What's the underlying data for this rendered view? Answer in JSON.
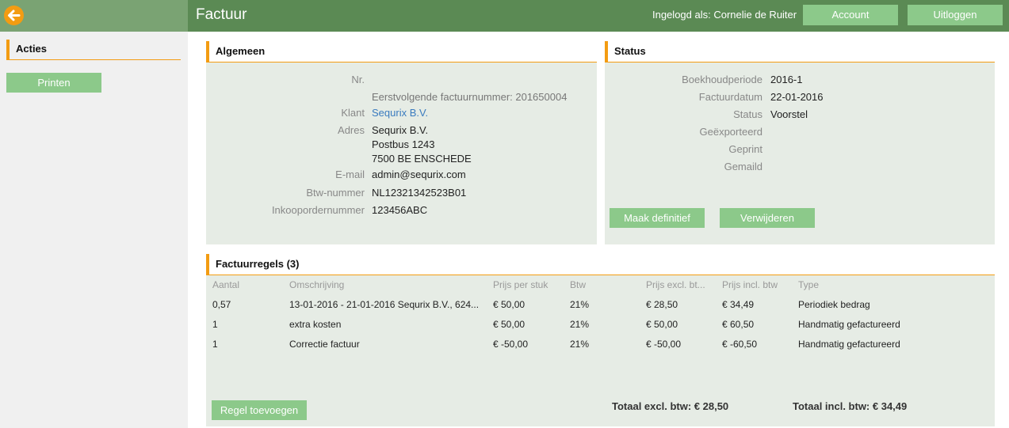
{
  "header": {
    "title": "Factuur",
    "login_label": "Ingelogd als: Cornelie de Ruiter",
    "account_label": "Account",
    "logout_label": "Uitloggen"
  },
  "sidebar": {
    "section_title": "Acties",
    "print_label": "Printen"
  },
  "general": {
    "title": "Algemeen",
    "rows": [
      {
        "label": "Nr.",
        "value": ""
      },
      {
        "label": "",
        "value": "Eerstvolgende factuurnummer: 201650004"
      },
      {
        "label": "Klant",
        "value": "Sequrix B.V."
      },
      {
        "label": "Adres",
        "lines": [
          "Sequrix B.V.",
          "Postbus 1243",
          "7500 BE ENSCHEDE"
        ]
      },
      {
        "label": "E-mail",
        "value": "admin@sequrix.com"
      },
      {
        "label": "Btw-nummer",
        "value": "NL12321342523B01"
      },
      {
        "label": "Inkoopordernummer",
        "value": "123456ABC"
      }
    ]
  },
  "status": {
    "title": "Status",
    "rows": [
      {
        "label": "Boekhoudperiode",
        "value": "2016-1"
      },
      {
        "label": "Factuurdatum",
        "value": "22-01-2016"
      },
      {
        "label": "Status",
        "value": "Voorstel"
      },
      {
        "label": "Geëxporteerd",
        "value": ""
      },
      {
        "label": "Geprint",
        "value": ""
      },
      {
        "label": "Gemaild",
        "value": ""
      }
    ],
    "finalize_label": "Maak definitief",
    "delete_label": "Verwijderen"
  },
  "lines": {
    "title": "Factuurregels (3)",
    "columns": [
      "Aantal",
      "Omschrijving",
      "Prijs per stuk",
      "Btw",
      "Prijs excl. bt...",
      "Prijs incl. btw",
      "Type"
    ],
    "rows": [
      [
        "0,57",
        "13-01-2016 - 21-01-2016 Sequrix B.V., 624...",
        "€ 50,00",
        "21%",
        "€ 28,50",
        "€ 34,49",
        "Periodiek bedrag"
      ],
      [
        "1",
        "extra kosten",
        "€ 50,00",
        "21%",
        "€ 50,00",
        "€ 60,50",
        "Handmatig gefactureerd"
      ],
      [
        "1",
        "Correctie factuur",
        "€ -50,00",
        "21%",
        "€ -50,00",
        "€ -60,50",
        "Handmatig gefactureerd"
      ]
    ],
    "add_label": "Regel toevoegen",
    "total_excl": "Totaal excl. btw: € 28,50",
    "total_incl": "Totaal incl. btw: € 34,49"
  },
  "colors": {
    "topbar": "#5b8a54",
    "accent": "#f39c12",
    "button": "#8cc98a",
    "panel": "#e6ece5"
  },
  "icons": {
    "back": "arrow-left-icon"
  }
}
